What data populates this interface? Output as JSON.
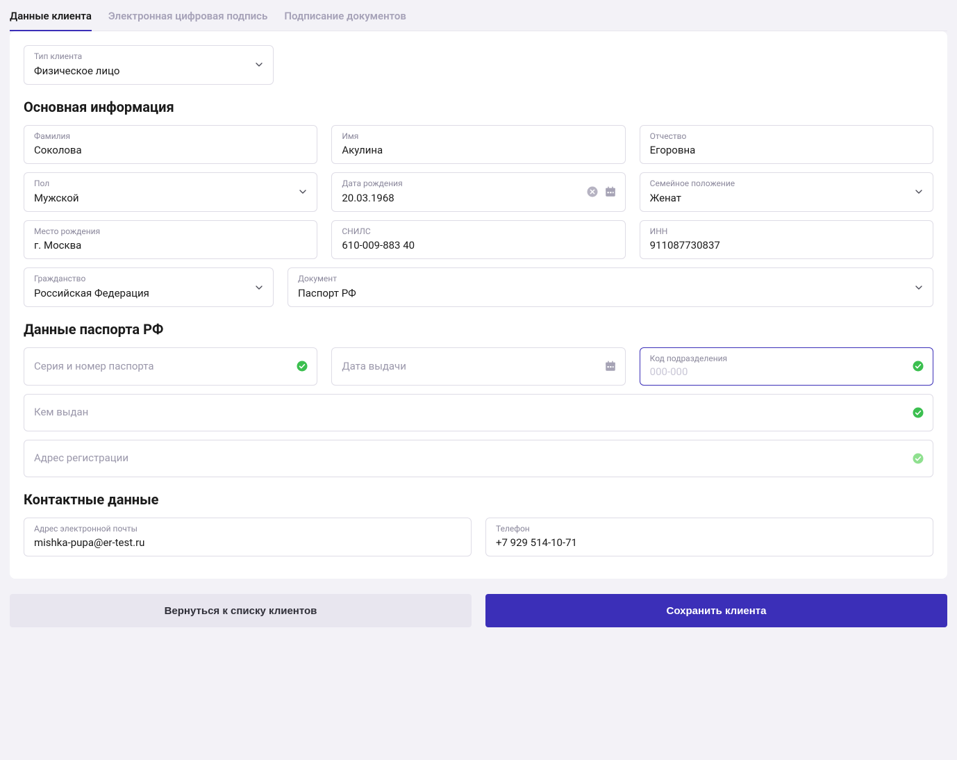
{
  "tabs": {
    "client_data": "Данные клиента",
    "eds": "Электронная цифровая подпись",
    "sign_docs": "Подписание документов"
  },
  "client_type": {
    "label": "Тип клиента",
    "value": "Физическое лицо"
  },
  "section_main": "Основная информация",
  "fields": {
    "lastname": {
      "label": "Фамилия",
      "value": "Соколова"
    },
    "firstname": {
      "label": "Имя",
      "value": "Акулина"
    },
    "patronymic": {
      "label": "Отчество",
      "value": "Егоровна"
    },
    "gender": {
      "label": "Пол",
      "value": "Мужской"
    },
    "dob": {
      "label": "Дата рождения",
      "value": "20.03.1968"
    },
    "marital": {
      "label": "Семейное положение",
      "value": "Женат"
    },
    "birthplace": {
      "label": "Место рождения",
      "value": "г. Москва"
    },
    "snils": {
      "label": "СНИЛС",
      "value": "610-009-883 40"
    },
    "inn": {
      "label": "ИНН",
      "value": "911087730837"
    },
    "citizenship": {
      "label": "Гражданство",
      "value": "Российская Федерация"
    },
    "document": {
      "label": "Документ",
      "value": "Паспорт РФ"
    }
  },
  "section_passport": "Данные паспорта РФ",
  "passport": {
    "series": {
      "placeholder": "Серия и номер паспорта"
    },
    "issue_date": {
      "placeholder": "Дата выдачи"
    },
    "dept_code": {
      "label": "Код подразделения",
      "placeholder": "000-000"
    },
    "issued_by": {
      "placeholder": "Кем выдан"
    },
    "reg_addr": {
      "placeholder": "Адрес регистрации"
    }
  },
  "section_contacts": "Контактные данные",
  "contacts": {
    "email": {
      "label": "Адрес электронной почты",
      "value": "mishka-pupa@er-test.ru"
    },
    "phone": {
      "label": "Телефон",
      "value": "+7 929 514-10-71"
    }
  },
  "buttons": {
    "back": "Вернуться к списку клиентов",
    "save": "Сохранить клиента"
  }
}
